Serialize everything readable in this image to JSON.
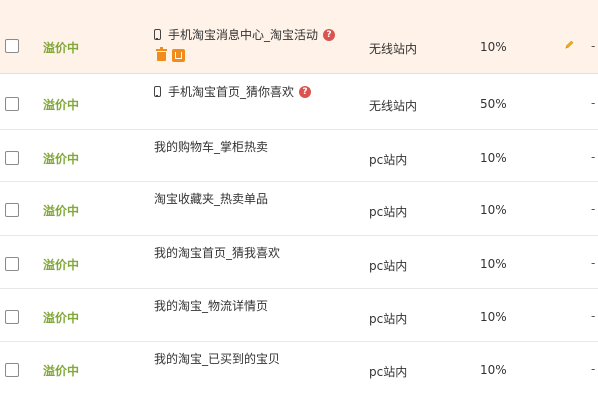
{
  "rows": [
    {
      "status": "溢价中",
      "name": "手机淘宝消息中心_淘宝活动",
      "mobile": true,
      "help": "?",
      "place": "无线站内",
      "pct": "10%",
      "extra": "-"
    },
    {
      "status": "溢价中",
      "name": "手机淘宝首页_猜你喜欢",
      "mobile": true,
      "help": "?",
      "place": "无线站内",
      "pct": "50%",
      "extra": "-"
    },
    {
      "status": "溢价中",
      "name": "我的购物车_掌柜热卖",
      "mobile": false,
      "place": "pc站内",
      "pct": "10%",
      "extra": "-"
    },
    {
      "status": "溢价中",
      "name": "淘宝收藏夹_热卖单品",
      "mobile": false,
      "place": "pc站内",
      "pct": "10%",
      "extra": "-"
    },
    {
      "status": "溢价中",
      "name": "我的淘宝首页_猜我喜欢",
      "mobile": false,
      "place": "pc站内",
      "pct": "10%",
      "extra": "-"
    },
    {
      "status": "溢价中",
      "name": "我的淘宝_物流详情页",
      "mobile": false,
      "place": "pc站内",
      "pct": "10%",
      "extra": "-"
    },
    {
      "status": "溢价中",
      "name": "我的淘宝_已买到的宝贝",
      "mobile": false,
      "place": "pc站内",
      "pct": "10%",
      "extra": "-"
    }
  ],
  "colors": {
    "status": "#82a83b",
    "highlight_row": "#fff2e8",
    "icon_orange": "#f08c1e",
    "help_red": "#d9534f"
  },
  "icons": {
    "device": "mobile-phone-icon",
    "help": "help-icon",
    "delete": "trash-icon",
    "shop": "shop-icon",
    "edit": "pencil-icon"
  }
}
